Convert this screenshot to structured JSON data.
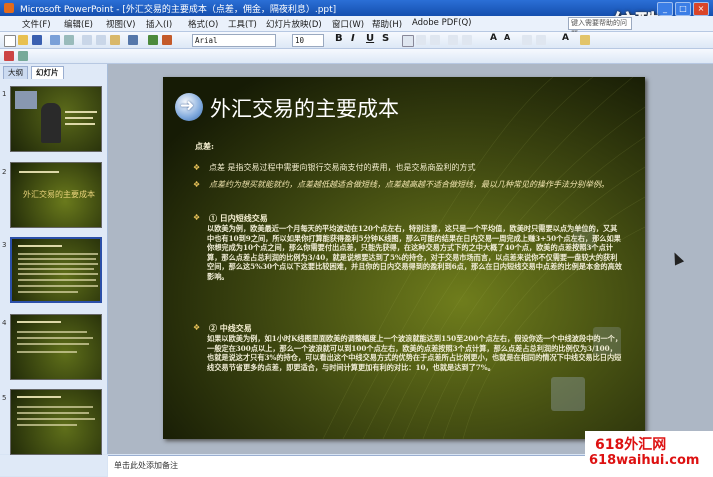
{
  "window": {
    "title": "Microsoft PowerPoint - [外汇交易的主要成本（点差，佣金，隔夜利息）.ppt]",
    "help_placeholder": "键入需要帮助的问题",
    "logo_text": "统酷"
  },
  "menu": [
    "文件(F)",
    "编辑(E)",
    "视图(V)",
    "插入(I)",
    "格式(O)",
    "工具(T)",
    "幻灯片放映(D)",
    "窗口(W)",
    "帮助(H)",
    "Adobe PDF(Q)"
  ],
  "toolbar": {
    "font": "Arial",
    "font_size": "10",
    "bold": "B",
    "italic": "I",
    "underline": "U",
    "shadow": "S"
  },
  "panel_tabs": [
    "大纲",
    "幻灯片"
  ],
  "slide_numbers": [
    "1",
    "2",
    "3",
    "4",
    "5"
  ],
  "thumbnail_titles": {
    "slide2": "外汇交易的主要成本"
  },
  "slide": {
    "title": "外汇交易的主要成本",
    "heading": "点差:",
    "bullet1": "点差 是指交易过程中需要向银行交易商支付的费用，也是交易商盈利的方式",
    "bullet2": "点差约为想买就能就约，点差越低越适合做短线，点差越高越不适合做短线，最以几种常见的操作手法分别举例。",
    "section1_title": "① 日内短线交易",
    "section1_body": "以欧美为例，欧美最近一个月每天的平均波动在120个点左右，特别注意，这只是一个平均值，欧美时只需要以点为单位的，又其中也有10到9之间，所以如果你打算能获得盈利5分钟K线图，那么可能的结果在日内交易一周完成上赚3+50个点左右，那么如果你想完成为10个点之间，那么你需要付出点差，只能先获得，在这种交易方式下的之中大概了40个点，欧美的点差按照3个点计算，那么点差占总利润的比例为3/40，就是说想要达到了5%的持仓，对于交易市场而言，以点差来说你不仅需要一盘较大的获利空间，那么这5%30个点以下这要比较困难，并且你的日内交易得到的盈利到6点，那么在日内短线交易中点差的比例是本金的高效影响。",
    "section2_title": "② 中线交易",
    "section2_body": "如果以欧美为例，如1小时K线图里面欧美的调整幅度上一个波浪就能达到150至200个点左右，假设你选一个中线波段中的一个，一般定在300点以上，那么一个波浪就可以到100个点左右，欧美的点差按照3个点计算，那么点差占总利润的比例仅为3/100，也就是说这才只有3%的持仓，可以看出这个中线交易方式的优势在于点差所占比例更小，也就是在相同的情况下中线交易比日内短线交易节省更多的点差，即更适合，与时间计算更加有利的对比：10，也就是达到了7%。"
  },
  "notes_placeholder": "单击此处添加备注",
  "watermark": {
    "line1": "618外汇网",
    "line2": "618waihui.com"
  }
}
